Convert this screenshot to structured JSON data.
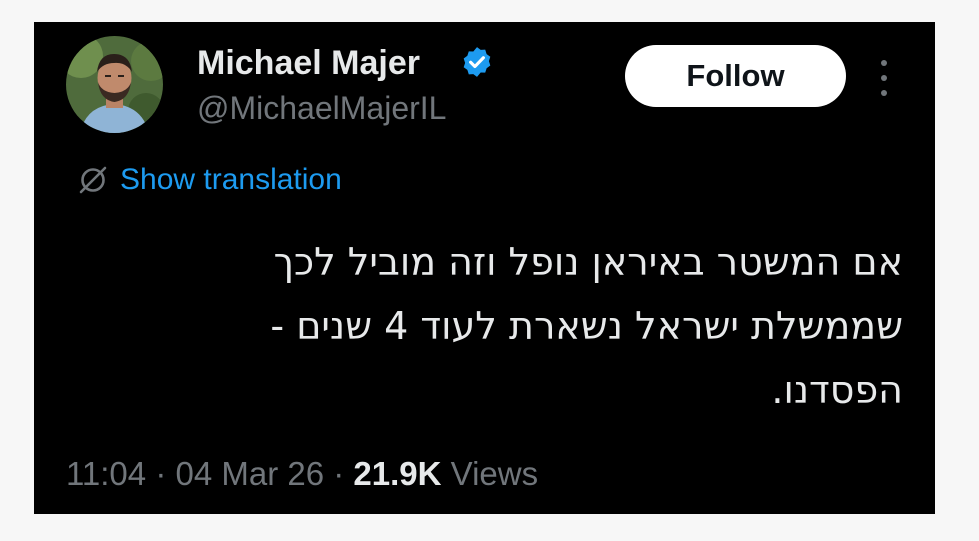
{
  "author": {
    "name": "Michael Majer",
    "handle": "@MichaelMajerIL",
    "verified": true,
    "verified_color": "#1d9bf0"
  },
  "actions": {
    "follow_label": "Follow",
    "translate_label": "Show translation"
  },
  "tweet": {
    "lines": [
      "אם המשטר באיראן נופל וזה מוביל לכך",
      "שממשלת ישראל נשארת לעוד 4 שנים -",
      "הפסדנו."
    ]
  },
  "meta": {
    "time": "11:04",
    "separator": "·",
    "date": "04 Mar 26",
    "views_count": "21.9K",
    "views_label": "Views"
  },
  "colors": {
    "background": "#000000",
    "text": "#e7e9ea",
    "secondary": "#71767b",
    "link": "#1d9bf0"
  },
  "icons": [
    "verified-icon",
    "translate-icon",
    "more-icon"
  ]
}
